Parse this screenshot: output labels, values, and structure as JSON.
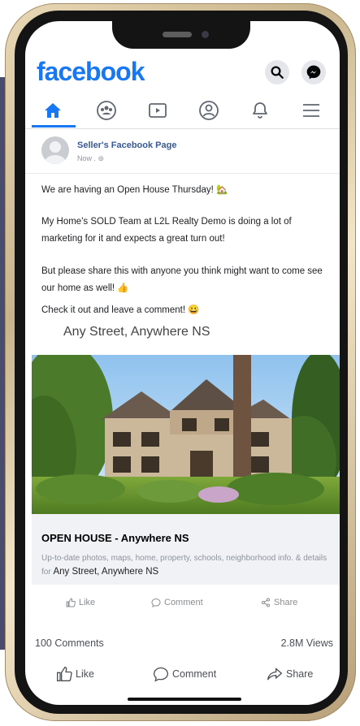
{
  "header": {
    "logo": "facebook",
    "search_icon": "search-icon",
    "messenger_icon": "messenger-icon"
  },
  "nav": {
    "items": [
      "home-icon",
      "groups-icon",
      "video-icon",
      "profile-icon",
      "notifications-icon",
      "menu-icon"
    ],
    "active": "home-icon"
  },
  "post": {
    "page_name": "Seller's Facebook Page",
    "time": "Now . ⊛",
    "line1": "We are having an Open House Thursday! 🏡",
    "line2": "My Home's SOLD Team at L2L Realty Demo is doing a lot of marketing for it and expects a great turn out!",
    "line3": "But please share this with anyone you think might want to come see our home as well! 👍",
    "line4": "Check it out and leave a comment! 😀",
    "address": "Any Street, Anywhere NS"
  },
  "link_card": {
    "title_prefix": "OPEN HOUSE - ",
    "title_location": "Anywhere NS",
    "description": "Up-to-date photos, maps, home, property, schools, neighborhood info. & details for",
    "description_address": "Any Street, Anywhere NS"
  },
  "card_actions": {
    "like": "Like",
    "comment": "Comment",
    "share": "Share"
  },
  "stats": {
    "comments": "100 Comments",
    "views": "2.8M Views"
  },
  "bottom_actions": {
    "like": "Like",
    "comment": "Comment",
    "share": "Share"
  },
  "colors": {
    "brand": "#1877f2",
    "link_name": "#385898",
    "muted": "#8a8d91",
    "frame": "#d8c39a"
  }
}
